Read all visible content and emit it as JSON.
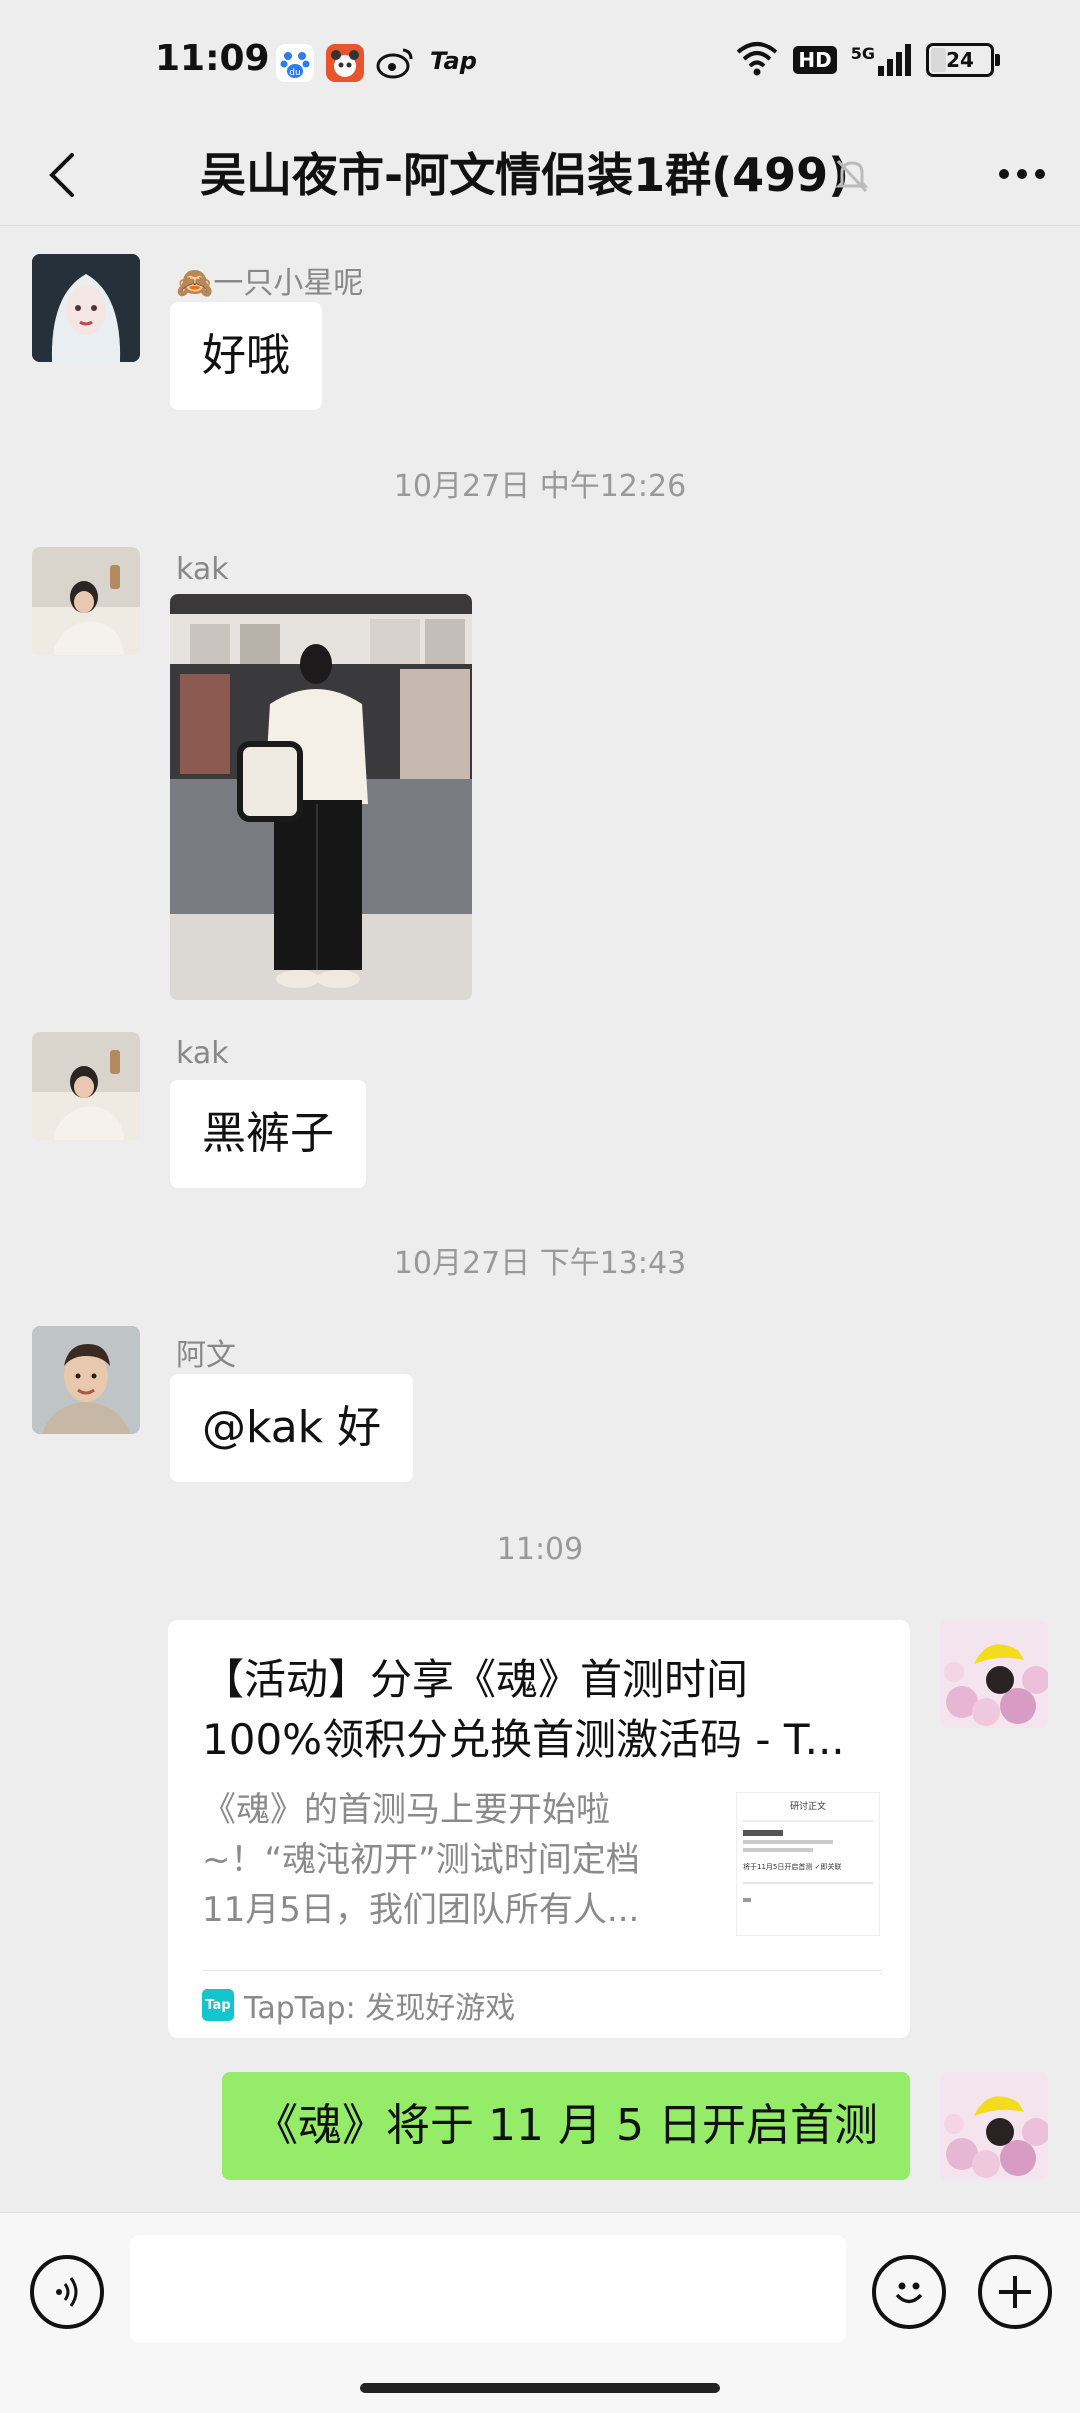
{
  "status_bar": {
    "time": "11:09",
    "app_icons": [
      "baidu-icon",
      "panda-app-icon",
      "weibo-icon",
      "taptap-icon"
    ],
    "tap_label": "Tap",
    "network_label": "5G",
    "hd_label": "HD",
    "battery": "24"
  },
  "header": {
    "title": "吴山夜市-阿文情侣装1群(499)",
    "back_icon": "chevron-left-icon",
    "mute_icon": "bell-muted-icon",
    "more_icon": "more-dots-icon"
  },
  "messages": [
    {
      "sender": "🙈一只小星呢",
      "text": "好哦"
    },
    {
      "timestamp": "10月27日 中午12:26"
    },
    {
      "sender": "kak",
      "type": "image"
    },
    {
      "sender": "kak",
      "text": "黑裤子"
    },
    {
      "timestamp": "10月27日 下午13:43"
    },
    {
      "sender": "阿文",
      "text": "@kak 好"
    },
    {
      "timestamp": "11:09"
    },
    {
      "type": "link-card",
      "title_line1": "【活动】分享《魂》首测时间",
      "title_line2": "100%领积分兑换首测激活码 - T...",
      "desc_line1": "《魂》的首测马上要开始啦",
      "desc_line2": "~！“魂沌初开”测试时间定档",
      "desc_line3": "11月5日，我们团队所有人...",
      "source": "TapTap: 发现好游戏",
      "source_logo": "Tap"
    },
    {
      "text": "《魂》将于 11 月 5 日开启首测",
      "me": true
    }
  ],
  "thumb_text": {
    "heading": "研讨正文",
    "line": "将于11月5日开启首测 ✓即关联"
  },
  "input_bar": {
    "voice_icon": "voice-icon",
    "emoji_icon": "emoji-icon",
    "plus_icon": "plus-icon"
  },
  "colors": {
    "background": "#ededed",
    "bubble_me": "#95ec69",
    "bubble_other": "#ffffff",
    "taptap": "#15c5ce"
  }
}
